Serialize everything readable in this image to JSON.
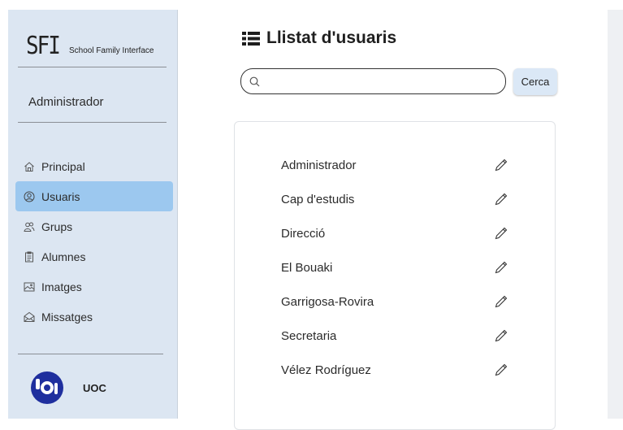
{
  "brand": {
    "logo": "SFI",
    "name": "School Family Interface"
  },
  "sidebar": {
    "role": "Administrador",
    "items": [
      {
        "label": "Principal",
        "icon": "home-icon",
        "active": false
      },
      {
        "label": "Usuaris",
        "icon": "user-circle-icon",
        "active": true
      },
      {
        "label": "Grups",
        "icon": "group-icon",
        "active": false
      },
      {
        "label": "Alumnes",
        "icon": "clipboard-icon",
        "active": false
      },
      {
        "label": "Imatges",
        "icon": "image-icon",
        "active": false
      },
      {
        "label": "Missatges",
        "icon": "envelope-icon",
        "active": false
      }
    ],
    "org": {
      "name": "UOC"
    }
  },
  "main": {
    "title": "Llistat d'usuaris",
    "search": {
      "placeholder": "",
      "value": ""
    },
    "search_button": "Cerca",
    "users": [
      "Administrador",
      "Cap d'estudis",
      "Direcció",
      "El Bouaki",
      "Garrigosa-Rovira",
      "Secretaria",
      "Vélez Rodríguez"
    ]
  },
  "colors": {
    "sidebar_bg": "#dce6f2",
    "active_item": "#9cc8ef",
    "button_bg": "#dbe8f6",
    "org_logo": "#1f2f9e"
  }
}
